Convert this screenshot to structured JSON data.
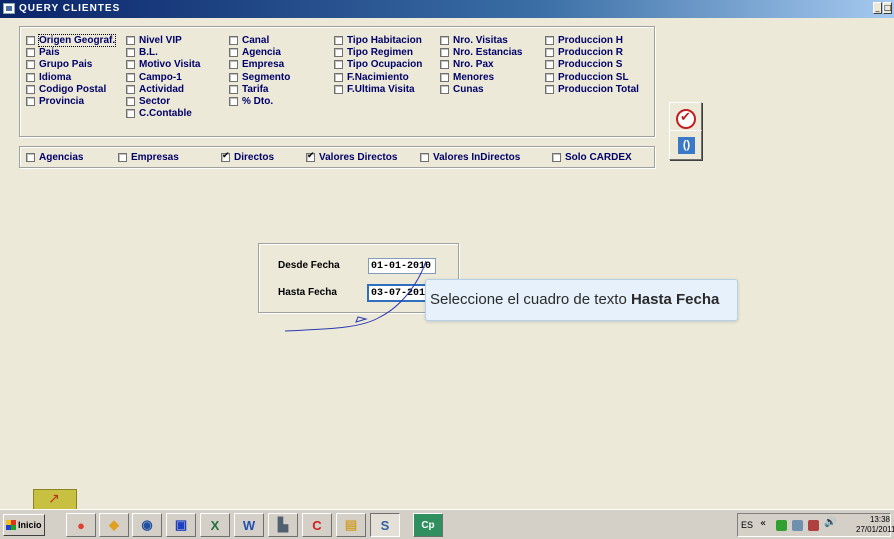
{
  "window": {
    "title": "QUERY CLIENTES",
    "controls": [
      "_",
      "□"
    ]
  },
  "fields": [
    {
      "label": "Origen Geograf.",
      "checked": false,
      "focused": true
    },
    {
      "label": "Pais",
      "checked": false
    },
    {
      "label": "Grupo Pais",
      "checked": false
    },
    {
      "label": "Idioma",
      "checked": false
    },
    {
      "label": "Codigo Postal",
      "checked": false
    },
    {
      "label": "Provincia",
      "checked": false
    },
    {
      "label": "Nivel VIP",
      "checked": false
    },
    {
      "label": "B.L.",
      "checked": false
    },
    {
      "label": "Motivo Visita",
      "checked": false
    },
    {
      "label": "Campo-1",
      "checked": false
    },
    {
      "label": "Actividad",
      "checked": false
    },
    {
      "label": "Sector",
      "checked": false
    },
    {
      "label": "C.Contable",
      "checked": false
    },
    {
      "label": "Canal",
      "checked": false
    },
    {
      "label": "Agencia",
      "checked": false
    },
    {
      "label": "Empresa",
      "checked": false
    },
    {
      "label": "Segmento",
      "checked": false
    },
    {
      "label": "Tarifa",
      "checked": false
    },
    {
      "label": "% Dto.",
      "checked": false
    },
    {
      "label": "Tipo Habitacion",
      "checked": false
    },
    {
      "label": "Tipo Regimen",
      "checked": false
    },
    {
      "label": "Tipo Ocupacion",
      "checked": false
    },
    {
      "label": "F.Nacimiento",
      "checked": false
    },
    {
      "label": "F.Ultima Visita",
      "checked": false
    },
    {
      "label": "Nro. Visitas",
      "checked": false
    },
    {
      "label": "Nro. Estancias",
      "checked": false
    },
    {
      "label": "Nro. Pax",
      "checked": false
    },
    {
      "label": "Menores",
      "checked": false
    },
    {
      "label": "Cunas",
      "checked": false
    },
    {
      "label": "Produccion H",
      "checked": false
    },
    {
      "label": "Produccion R",
      "checked": false
    },
    {
      "label": "Produccion S",
      "checked": false
    },
    {
      "label": "Produccion SL",
      "checked": false
    },
    {
      "label": "Produccion Total",
      "checked": false
    }
  ],
  "options": [
    {
      "label": "Agencias",
      "checked": false
    },
    {
      "label": "Empresas",
      "checked": false
    },
    {
      "label": "Directos",
      "checked": true
    },
    {
      "label": "Valores Directos",
      "checked": true
    },
    {
      "label": "Valores InDirectos",
      "checked": false
    },
    {
      "label": "Solo CARDEX",
      "checked": false
    }
  ],
  "dates": {
    "desde_label": "Desde Fecha",
    "desde_value": "01-01-2010",
    "hasta_label": "Hasta Fecha",
    "hasta_value": "03-07-2010"
  },
  "tooltip": {
    "prefix": "Seleccione el cuadro de texto ",
    "target": "Hasta Fecha"
  },
  "buttons": {
    "accept_icon": "check-circle-icon",
    "clear_icon": "clear-icon",
    "clear_symbol": "()"
  },
  "taskbar": {
    "start_label": "Inicio",
    "apps": [
      {
        "name": "chrome-icon",
        "glyph": "●",
        "color": "#e04030"
      },
      {
        "name": "explorer-icon",
        "glyph": "◆",
        "color": "#e0a020"
      },
      {
        "name": "thunderbird-icon",
        "glyph": "◉",
        "color": "#2050a0"
      },
      {
        "name": "save-disk-icon",
        "glyph": "▣",
        "color": "#2040c0"
      },
      {
        "name": "excel-icon",
        "glyph": "X",
        "color": "#207040"
      },
      {
        "name": "word-icon",
        "glyph": "W",
        "color": "#2050b0"
      },
      {
        "name": "network-icon",
        "glyph": "▙",
        "color": "#506070"
      },
      {
        "name": "ccleaner-icon",
        "glyph": "C",
        "color": "#d02020"
      },
      {
        "name": "folder-icon",
        "glyph": "▤",
        "color": "#d0a030"
      },
      {
        "name": "app-sm-icon",
        "glyph": "S",
        "color": "#3060a0"
      },
      {
        "name": "captivate-icon",
        "glyph": "Cp",
        "color": "#ffffff"
      }
    ],
    "tray": {
      "language": "ES",
      "time": "13:38",
      "date": "27/01/2011"
    }
  }
}
